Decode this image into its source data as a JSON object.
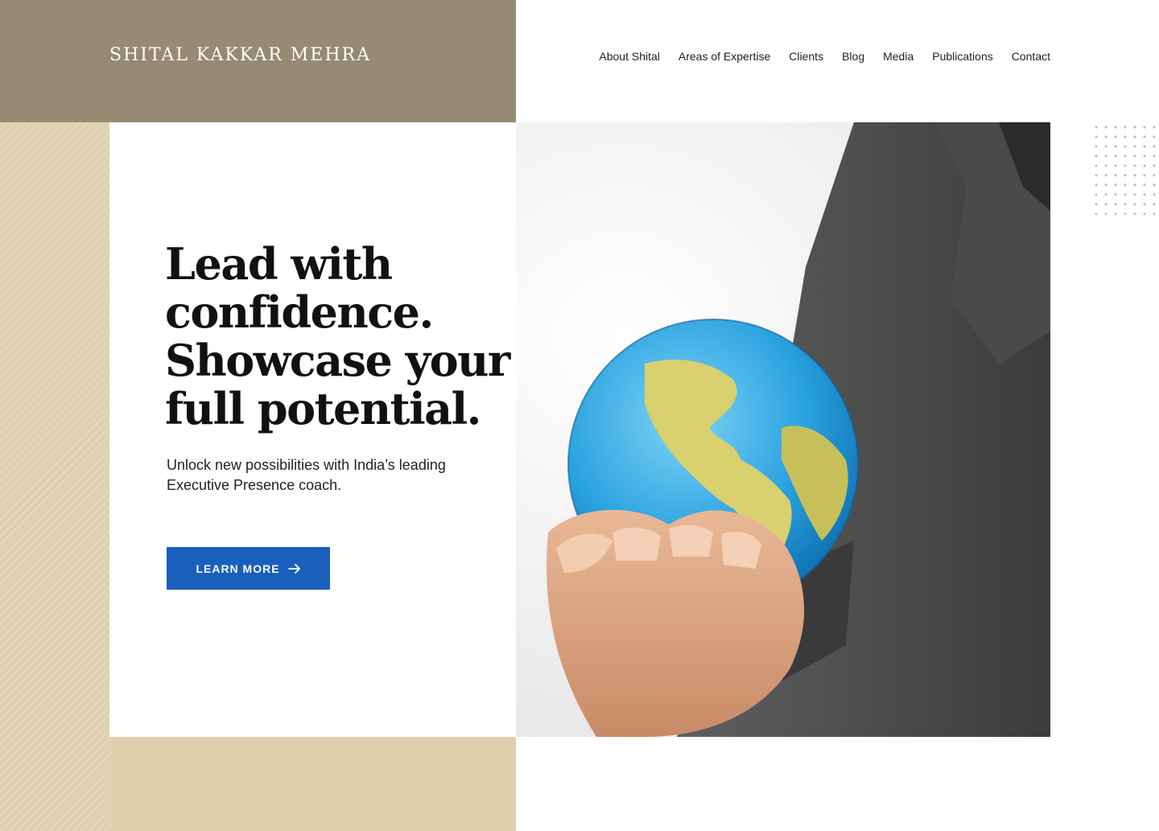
{
  "brand": {
    "name": "SHITAL KAKKAR MEHRA"
  },
  "nav": {
    "items": [
      "About Shital",
      "Areas of Expertise",
      "Clients",
      "Blog",
      "Media",
      "Publications",
      "Contact"
    ]
  },
  "hero": {
    "headline": "Lead with confidence. Showcase your full potential.",
    "subtext": "Unlock new possibilities with India’s leading Executive Presence coach.",
    "cta_label": "LEARN MORE",
    "cta_icon": "arrow-right-icon",
    "image_icon": "hand-holding-globe-photo"
  },
  "colors": {
    "header_band": "#978a73",
    "tan": "#dfd0ae",
    "cta": "#1a5fbc"
  }
}
